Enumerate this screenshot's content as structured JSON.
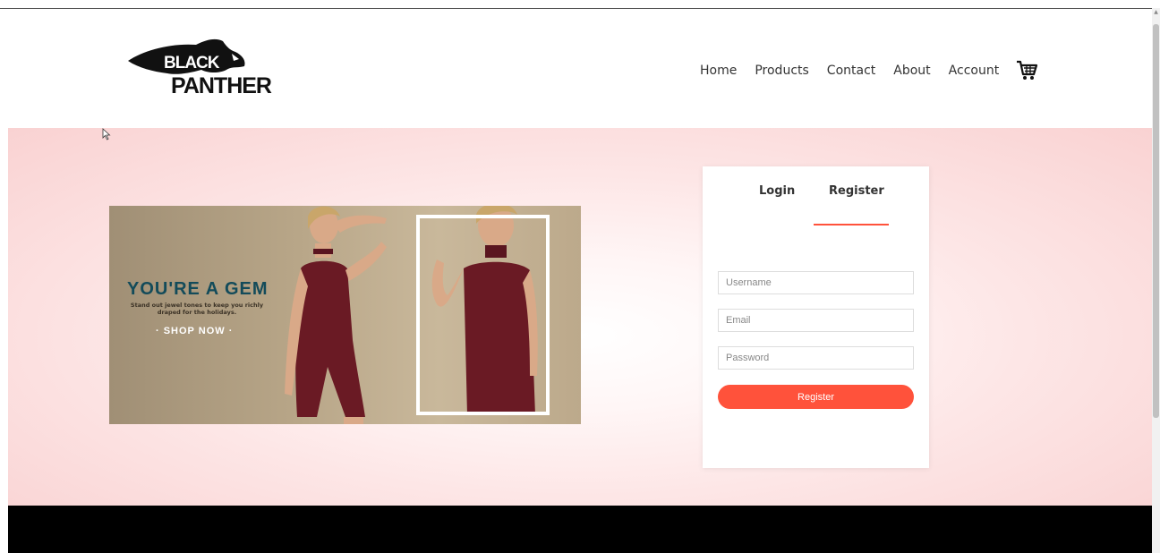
{
  "brand": {
    "logo_text_line1": "BLACK",
    "logo_text_line2": "PANTHER"
  },
  "nav": {
    "items": [
      "Home",
      "Products",
      "Contact",
      "About",
      "Account"
    ],
    "cart_icon": "shopping-cart-icon"
  },
  "banner": {
    "headline": "YOU'RE A GEM",
    "subtext": "Stand out jewel tones to keep you richly draped for the holidays.",
    "cta": "· SHOP NOW ·"
  },
  "auth": {
    "tabs": [
      "Login",
      "Register"
    ],
    "active_tab": "Register",
    "username_placeholder": "Username",
    "email_placeholder": "Email",
    "password_placeholder": "Password",
    "submit_label": "Register"
  },
  "colors": {
    "accent": "#ff523b",
    "hero_background": "#fde6e6",
    "footer": "#000000",
    "banner_headline": "#134b5a",
    "dress": "#6a1a24"
  }
}
